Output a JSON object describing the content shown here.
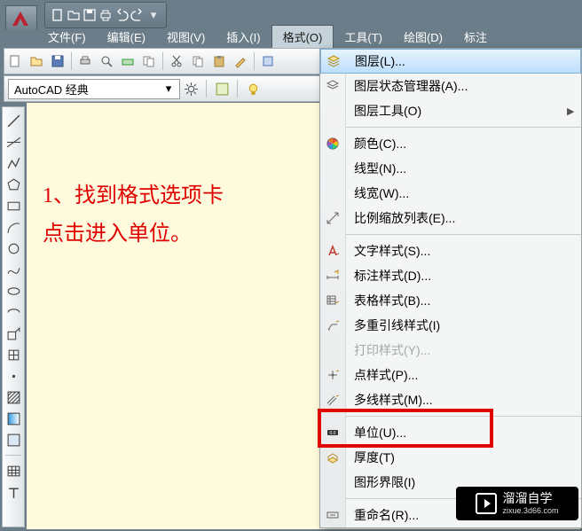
{
  "qat": {
    "icons": [
      "new",
      "open",
      "save",
      "print",
      "undo",
      "redo"
    ]
  },
  "menubar": {
    "items": [
      {
        "label": "文件(F)"
      },
      {
        "label": "编辑(E)"
      },
      {
        "label": "视图(V)"
      },
      {
        "label": "插入(I)"
      },
      {
        "label": "格式(O)",
        "active": true
      },
      {
        "label": "工具(T)"
      },
      {
        "label": "绘图(D)"
      },
      {
        "label": "标注"
      }
    ]
  },
  "style_selector": {
    "value": "AutoCAD 经典"
  },
  "annotation": {
    "line1": "1、找到格式选项卡",
    "line2": "点击进入单位。"
  },
  "format_menu": {
    "items": [
      {
        "icon": "layers-icon",
        "label": "图层(L)...",
        "highlighted": true
      },
      {
        "icon": "layer-state-icon",
        "label": "图层状态管理器(A)..."
      },
      {
        "icon": "",
        "label": "图层工具(O)",
        "arrow": true
      },
      {
        "sep": true
      },
      {
        "icon": "color-wheel-icon",
        "label": "颜色(C)..."
      },
      {
        "icon": "",
        "label": "线型(N)..."
      },
      {
        "icon": "",
        "label": "线宽(W)..."
      },
      {
        "icon": "scale-icon",
        "label": "比例缩放列表(E)..."
      },
      {
        "sep": true
      },
      {
        "icon": "text-style-icon",
        "label": "文字样式(S)..."
      },
      {
        "icon": "dim-style-icon",
        "label": "标注样式(D)..."
      },
      {
        "icon": "table-style-icon",
        "label": "表格样式(B)..."
      },
      {
        "icon": "mleader-icon",
        "label": "多重引线样式(I)"
      },
      {
        "icon": "",
        "label": "打印样式(Y)...",
        "disabled": true
      },
      {
        "icon": "point-style-icon",
        "label": "点样式(P)..."
      },
      {
        "icon": "mline-style-icon",
        "label": "多线样式(M)..."
      },
      {
        "sep": true
      },
      {
        "icon": "units-icon",
        "label": "单位(U)...",
        "boxed": true
      },
      {
        "icon": "thickness-icon",
        "label": "厚度(T)"
      },
      {
        "icon": "",
        "label": "图形界限(I)"
      },
      {
        "sep": true
      },
      {
        "icon": "rename-icon",
        "label": "重命名(R)..."
      }
    ]
  },
  "watermark": {
    "brand": "溜溜自学",
    "url": "zixue.3d66.com"
  }
}
